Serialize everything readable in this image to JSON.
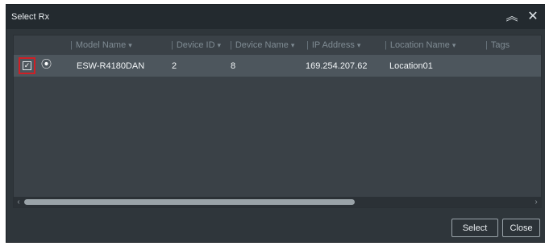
{
  "dialog": {
    "title": "Select Rx",
    "collapse_icon": "chevron-up-double-icon",
    "close_icon": "close-icon"
  },
  "columns": [
    {
      "label": "Model Name"
    },
    {
      "label": "Device ID"
    },
    {
      "label": "Device Name"
    },
    {
      "label": "IP Address"
    },
    {
      "label": "Location Name"
    },
    {
      "label": "Tags"
    }
  ],
  "rows": [
    {
      "checked": true,
      "icon": "device-target-icon",
      "model_name": "ESW-R4180DAN",
      "device_id": "2",
      "device_name": "8",
      "ip_address": "169.254.207.62",
      "location_name": "Location01",
      "tags": ""
    }
  ],
  "buttons": {
    "select": "Select",
    "close": "Close"
  }
}
